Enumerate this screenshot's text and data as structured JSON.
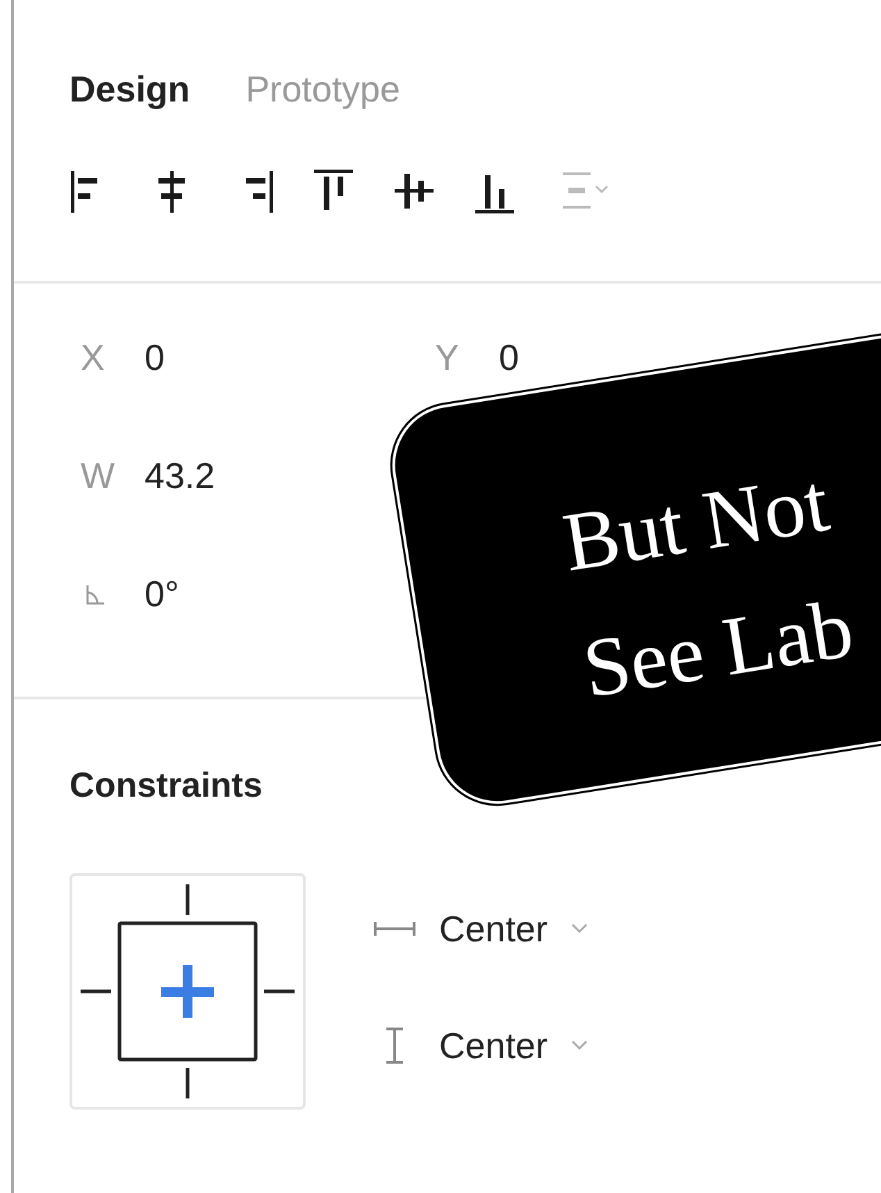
{
  "tabs": [
    {
      "label": "Design",
      "selected": true
    },
    {
      "label": "Prototype",
      "selected": false
    }
  ],
  "align_tools": [
    {
      "kind": "left",
      "disabled": false
    },
    {
      "kind": "hcenter",
      "disabled": false
    },
    {
      "kind": "right",
      "disabled": false
    },
    {
      "kind": "top",
      "disabled": false
    },
    {
      "kind": "vcenter",
      "disabled": false
    },
    {
      "kind": "bottom",
      "disabled": false
    },
    {
      "kind": "distribute",
      "disabled": true
    }
  ],
  "fields": [
    {
      "kind": "text",
      "label": "X",
      "value": "0"
    },
    {
      "kind": "text",
      "label": "Y",
      "value": "0"
    },
    {
      "kind": "text",
      "label": "W",
      "value": "43.2"
    },
    {
      "kind": "none"
    },
    {
      "kind": "angle",
      "value": "0°"
    }
  ],
  "constraints": {
    "title": "Constraints",
    "horizontal": "Center",
    "vertical": "Center"
  },
  "sticker": {
    "lines": [
      "But Not",
      "See Lab"
    ]
  }
}
